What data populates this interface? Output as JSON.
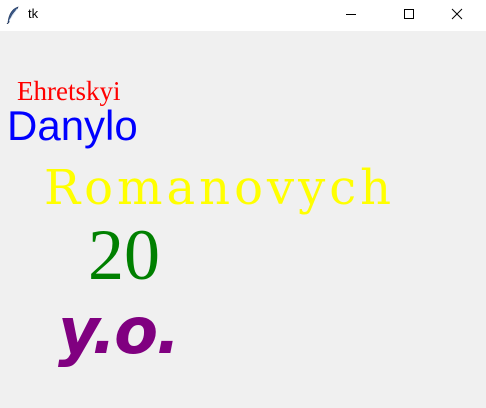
{
  "window": {
    "title": "tk",
    "icon": "feather-icon",
    "controls": {
      "minimize_icon": "minimize-icon",
      "maximize_icon": "maximize-icon",
      "close_icon": "close-icon"
    }
  },
  "labels": [
    {
      "text": "Ehretskyi",
      "color": "#ff0000"
    },
    {
      "text": "Danylo",
      "color": "#0000ff"
    },
    {
      "text": "Romanovych",
      "color": "#ffff00"
    },
    {
      "text": "20",
      "color": "#008000"
    },
    {
      "text": "y.o.",
      "color": "#800080"
    }
  ]
}
